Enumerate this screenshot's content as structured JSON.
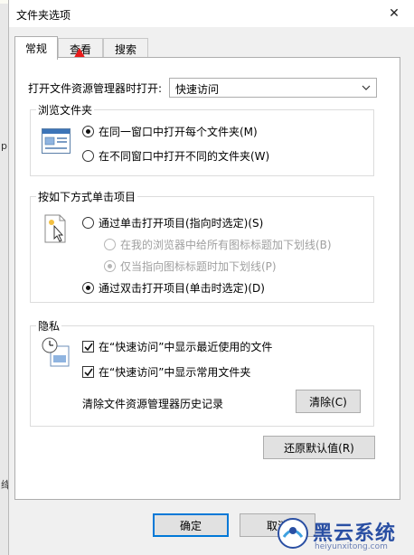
{
  "dialog": {
    "title": "文件夹选项",
    "close_glyph": "✕"
  },
  "tabs": [
    {
      "label": "常规",
      "active": true
    },
    {
      "label": "查看",
      "active": false
    },
    {
      "label": "搜索",
      "active": false
    }
  ],
  "open_explorer": {
    "label": "打开文件资源管理器时打开:",
    "value": "快速访问"
  },
  "browse_folders": {
    "title": "浏览文件夹",
    "options": [
      {
        "label": "在同一窗口中打开每个文件夹(M)",
        "checked": true
      },
      {
        "label": "在不同窗口中打开不同的文件夹(W)",
        "checked": false
      }
    ]
  },
  "click_items": {
    "title": "按如下方式单击项目",
    "options": [
      {
        "label": "通过单击打开项目(指向时选定)(S)",
        "checked": false,
        "disabled": false
      },
      {
        "label": "在我的浏览器中给所有图标标题加下划线(B)",
        "checked": false,
        "disabled": true
      },
      {
        "label": "仅当指向图标标题时加下划线(P)",
        "checked": true,
        "disabled": true
      },
      {
        "label": "通过双击打开项目(单击时选定)(D)",
        "checked": true,
        "disabled": false
      }
    ]
  },
  "privacy": {
    "title": "隐私",
    "checks": [
      {
        "label": "在“快速访问”中显示最近使用的文件",
        "checked": true
      },
      {
        "label": "在“快速访问”中显示常用文件夹",
        "checked": true
      }
    ],
    "clear_label": "清除文件资源管理器历史记录",
    "clear_button": "清除(C)"
  },
  "restore_button": "还原默认值(R)",
  "footer": {
    "ok": "确定",
    "cancel": "取消"
  },
  "background_fragments": {
    "left_p": "p",
    "left_jiang": "绛"
  },
  "watermark": {
    "brand": "黑云系统",
    "site": "heiyunxitong.com"
  },
  "colors": {
    "accent": "#0078d7",
    "arrow": "#e81b1b",
    "watermark": "#2a4fa3"
  }
}
